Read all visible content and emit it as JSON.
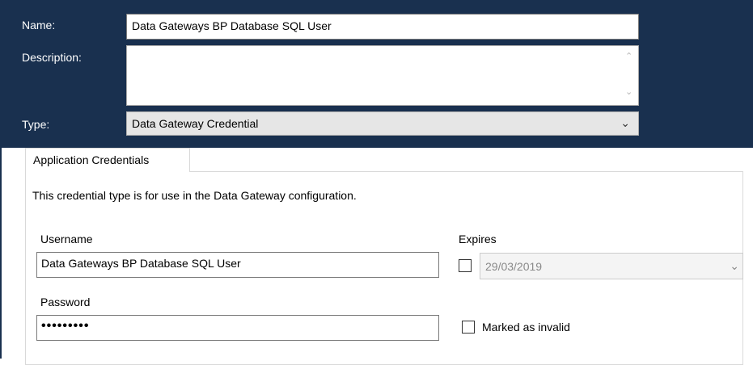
{
  "form": {
    "name_label": "Name:",
    "name_value": "Data Gateways BP Database SQL User",
    "description_label": "Description:",
    "description_value": "",
    "type_label": "Type:",
    "type_value": "Data Gateway Credential"
  },
  "tab": {
    "label": "Application Credentials",
    "info_text": "This credential type is for use in the Data Gateway configuration.",
    "username_label": "Username",
    "username_value": "Data Gateways BP Database SQL User",
    "password_label": "Password",
    "password_masked": "•••••••••",
    "expires_label": "Expires",
    "expires_checked": false,
    "expires_date": "29/03/2019",
    "invalid_label": "Marked as invalid",
    "invalid_checked": false
  },
  "colors": {
    "header_background": "#19304f",
    "tab_border": "#d9d9d9"
  },
  "icons": {
    "select_arrow": "chevron-down-icon",
    "scroll_up": "scroll-up-arrow-icon",
    "scroll_down": "scroll-down-arrow-icon"
  }
}
